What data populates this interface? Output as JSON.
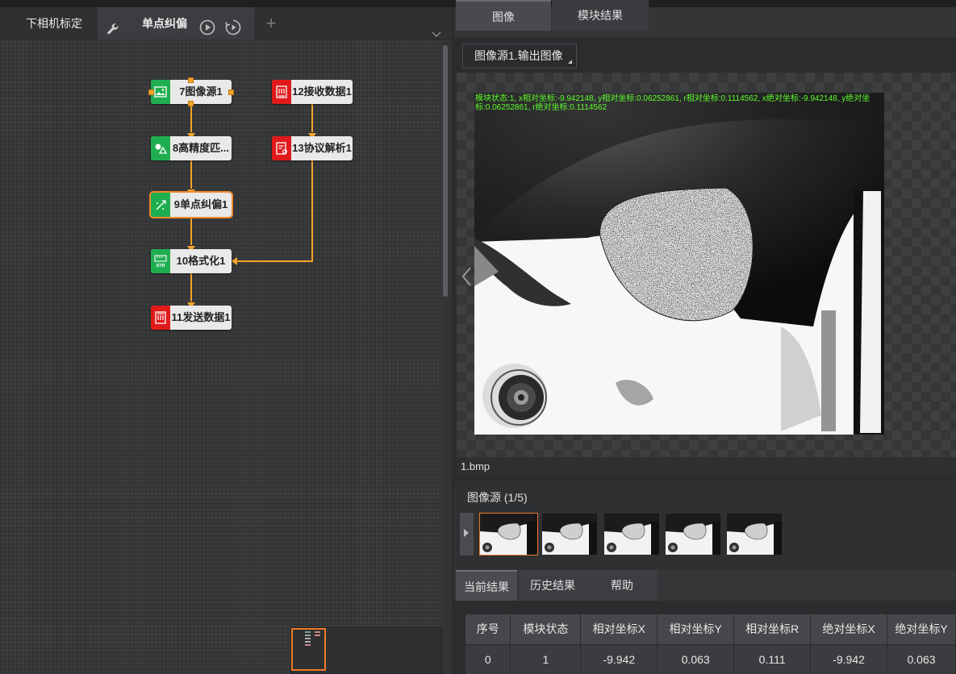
{
  "left_tabs": {
    "tab1": "下相机标定",
    "tab2": "单点纠偏",
    "add_glyph": "+",
    "wrench_icon": "wrench-icon",
    "run_icon": "play-circle-icon",
    "loop_icon": "loop-run-icon"
  },
  "flow": {
    "nodes": [
      {
        "id": "n7",
        "label": "7图像源1",
        "color": "#1fae4f",
        "icon": "image-icon"
      },
      {
        "id": "n12",
        "label": "12接收数据1",
        "color": "#e01a1a",
        "icon": "receive-data-icon"
      },
      {
        "id": "n8",
        "label": "8高精度匹...",
        "color": "#1fae4f",
        "icon": "match-icon"
      },
      {
        "id": "n13",
        "label": "13协议解析1",
        "color": "#e01a1a",
        "icon": "protocol-parse-icon"
      },
      {
        "id": "n9",
        "label": "9单点纠偏1",
        "color": "#1fae4f",
        "icon": "correction-icon"
      },
      {
        "id": "n10",
        "label": "10格式化1",
        "color": "#1fae4f",
        "icon": "format-str-icon"
      },
      {
        "id": "n11",
        "label": "11发送数据1",
        "color": "#e01a1a",
        "icon": "send-data-icon"
      }
    ]
  },
  "right_tabs": {
    "image": "图像",
    "module_result": "模块结果"
  },
  "image_selector": {
    "value": "图像源1.输出图像"
  },
  "overlay_text": "模块状态:1, x相对坐标:-9.942148, y相对坐标:0.06252861, r相对坐标:0.1114562, x绝对坐标:-9.942148, y绝对坐标:0.06252861, r绝对坐标:0.1114562",
  "filename": "1.bmp",
  "image_source": {
    "title": "图像源 (1/5)",
    "thumb_count": 5,
    "selected": 0
  },
  "bottom_tabs": {
    "current": "当前结果",
    "history": "历史结果",
    "help": "帮助"
  },
  "results": {
    "headers": [
      "序号",
      "模块状态",
      "相对坐标X",
      "相对坐标Y",
      "相对坐标R",
      "绝对坐标X",
      "绝对坐标Y"
    ],
    "rows": [
      [
        "0",
        "1",
        "-9.942",
        "0.063",
        "0.111",
        "-9.942",
        "0.063"
      ]
    ]
  },
  "colors": {
    "accent": "#f08a2a",
    "connector": "#f3a42a",
    "node_green": "#1fae4f",
    "node_red": "#e01a1a",
    "overlay_text": "#5bff2a"
  }
}
